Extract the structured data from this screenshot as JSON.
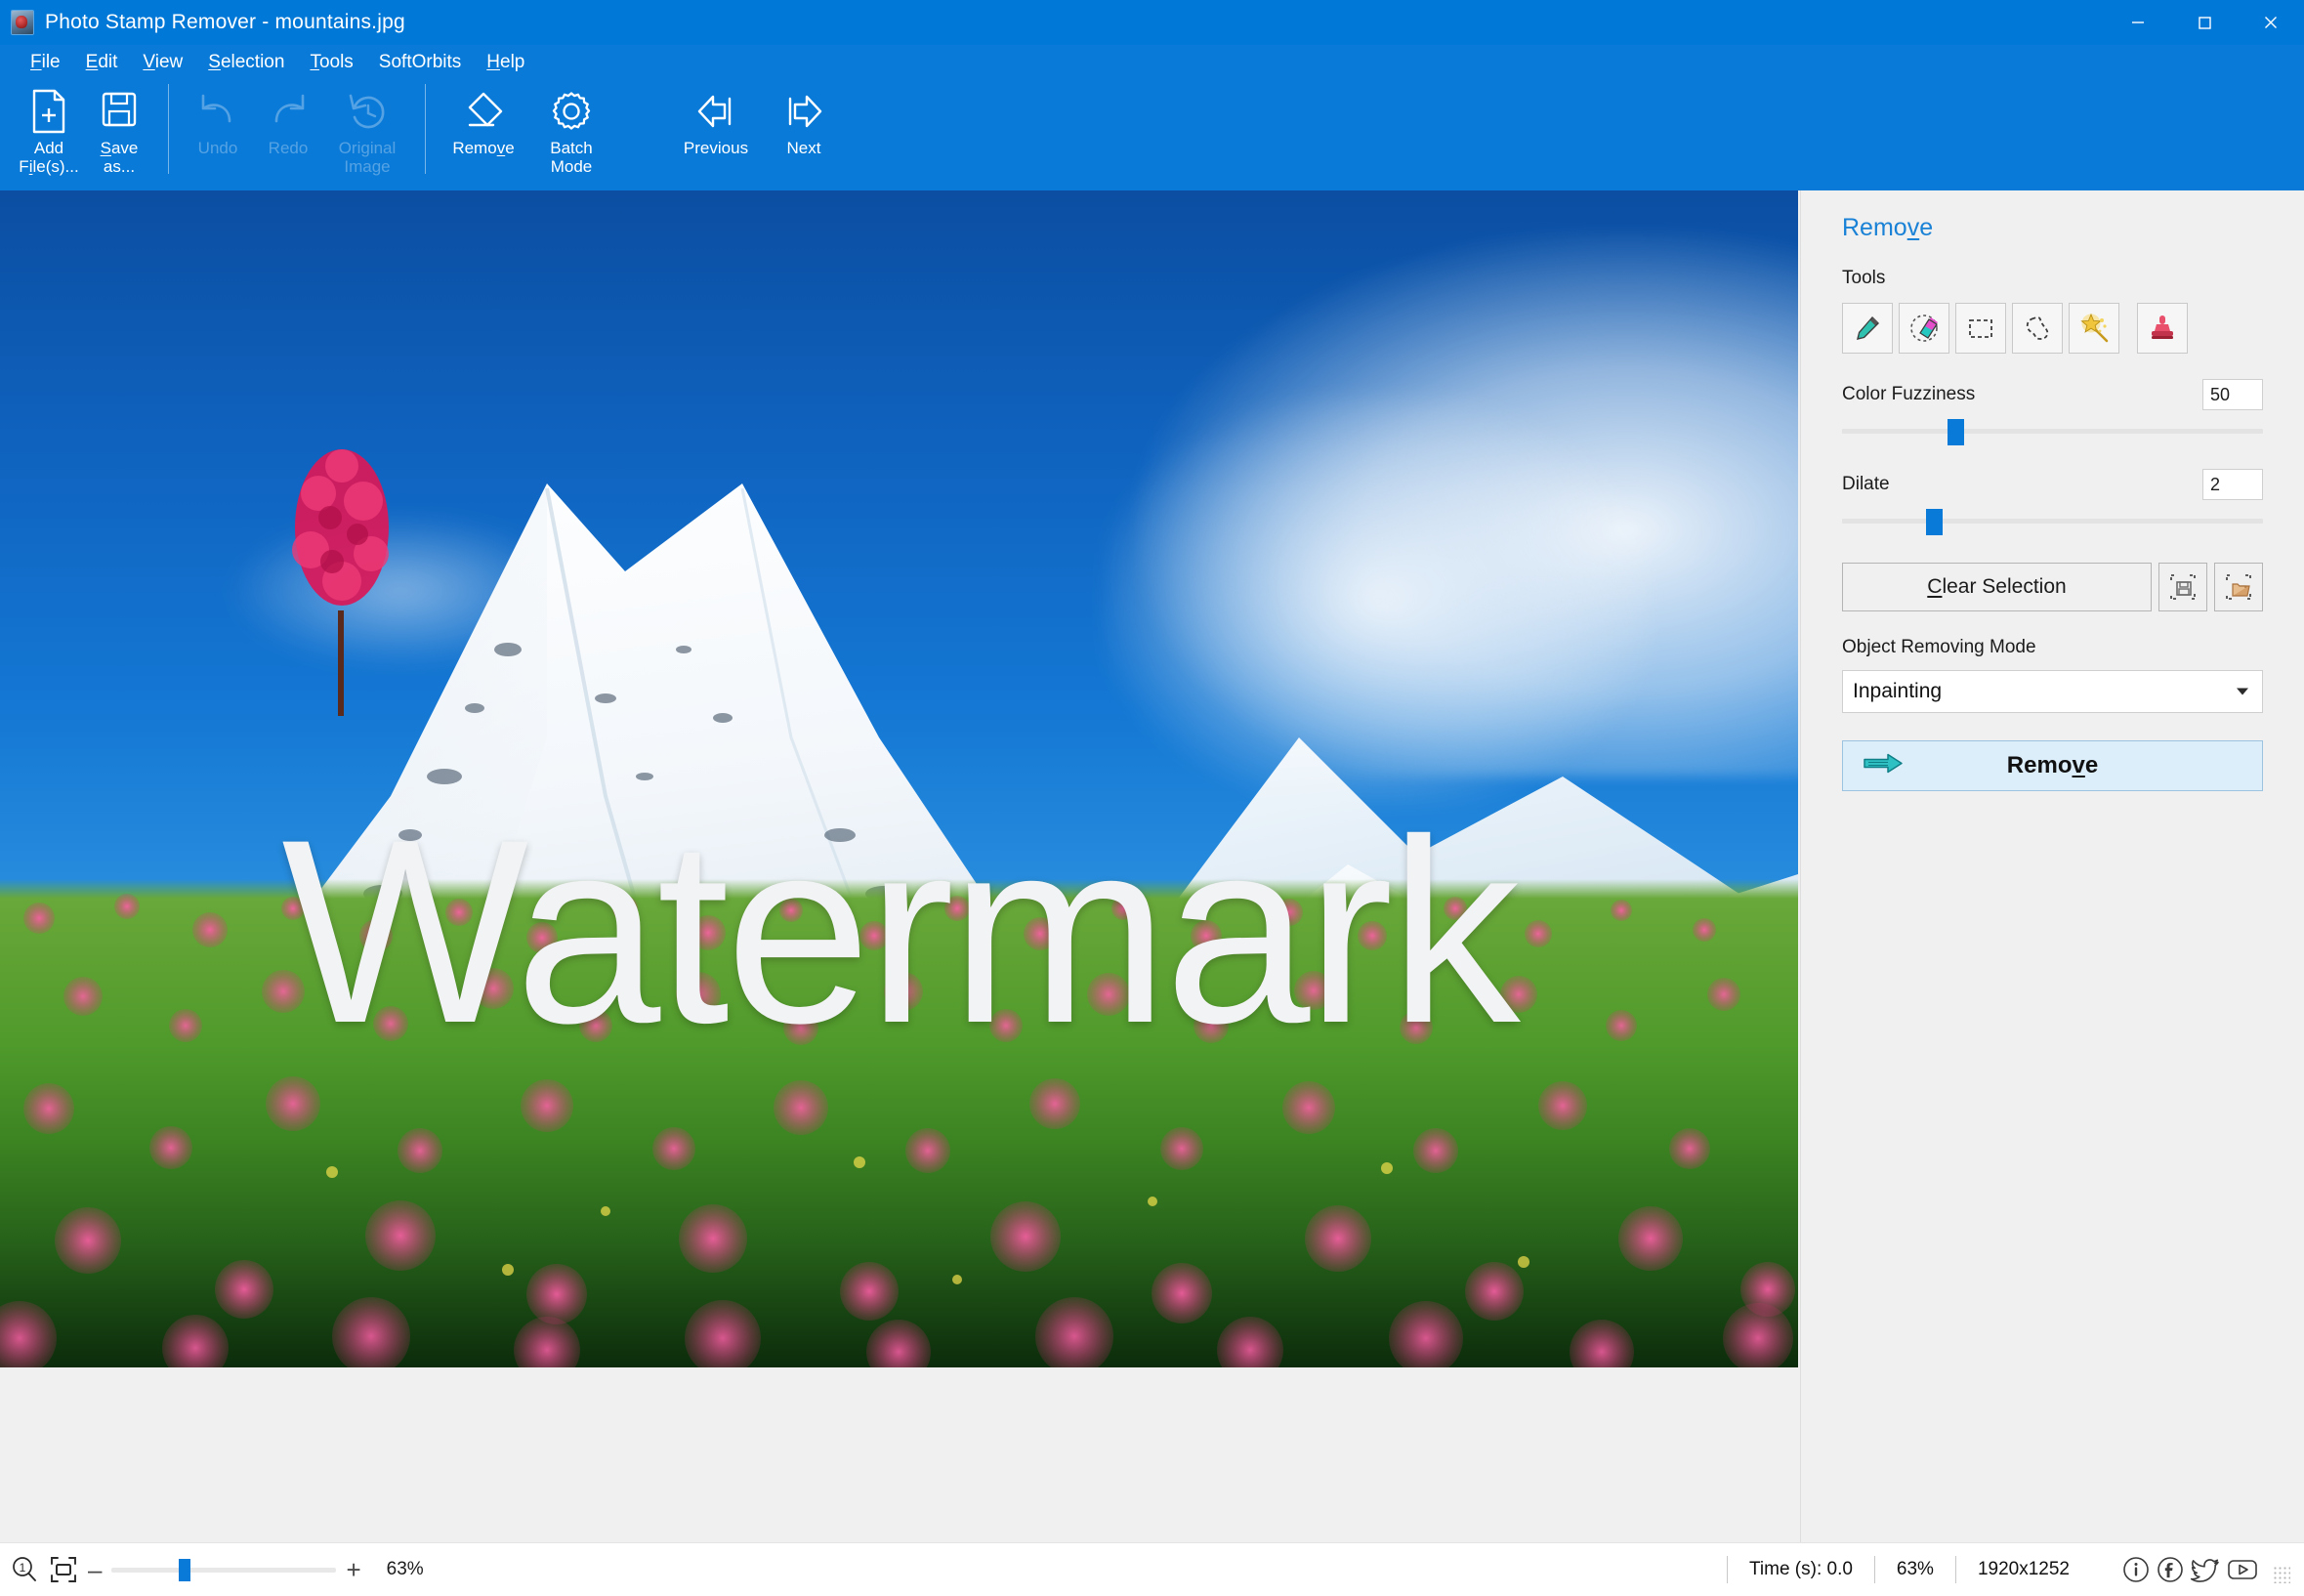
{
  "window": {
    "title": "Photo Stamp Remover - mountains.jpg",
    "app_icon": "app-photo-icon",
    "minimize": "minimize-icon",
    "maximize": "maximize-icon",
    "close": "close-icon",
    "titlebar_color": "#0078d7"
  },
  "menubar": {
    "items": [
      {
        "label": "File",
        "accel": "F"
      },
      {
        "label": "Edit",
        "accel": "E"
      },
      {
        "label": "View",
        "accel": "V"
      },
      {
        "label": "Selection",
        "accel": "S"
      },
      {
        "label": "Tools",
        "accel": "T"
      },
      {
        "label": "SoftOrbits",
        "accel": ""
      },
      {
        "label": "Help",
        "accel": "H"
      }
    ]
  },
  "toolbar": {
    "buttons": [
      {
        "label": "Add\nFile(s)...",
        "icon": "add-file-icon",
        "enabled": true,
        "accel": "l"
      },
      {
        "label": "Save\nas...",
        "icon": "save-as-icon",
        "enabled": true,
        "accel": "S"
      },
      {
        "label": "Undo",
        "icon": "undo-icon",
        "enabled": false
      },
      {
        "label": "Redo",
        "icon": "redo-icon",
        "enabled": false
      },
      {
        "label": "Original\nImage",
        "icon": "history-revert-icon",
        "enabled": false
      },
      {
        "label": "Remove",
        "icon": "eraser-icon",
        "enabled": true,
        "accel": "v"
      },
      {
        "label": "Batch\nMode",
        "icon": "gear-icon",
        "enabled": true
      },
      {
        "label": "Previous",
        "icon": "arrow-left-icon",
        "enabled": true
      },
      {
        "label": "Next",
        "icon": "arrow-right-icon",
        "enabled": true
      }
    ]
  },
  "canvas": {
    "watermark_text": "Watermark",
    "image_name": "mountains.jpg",
    "scene": "snow-capped mountains with pink flower meadow and red blossom tree"
  },
  "panel": {
    "title": "Remove",
    "title_accel": "v",
    "tools_label": "Tools",
    "tools": [
      {
        "name": "marker-tool",
        "selected": false
      },
      {
        "name": "eraser-tool",
        "selected": false
      },
      {
        "name": "rectangle-select-tool",
        "selected": false
      },
      {
        "name": "lasso-select-tool",
        "selected": false
      },
      {
        "name": "magic-wand-tool",
        "selected": false
      },
      {
        "name": "clone-stamp-tool",
        "selected": false
      }
    ],
    "color_fuzziness": {
      "label": "Color Fuzziness",
      "value": "50",
      "percent": 25
    },
    "dilate": {
      "label": "Dilate",
      "value": "2",
      "percent": 20
    },
    "clear_selection": {
      "label": "Clear Selection",
      "accel": "C"
    },
    "save_selection_icon": "save-selection-icon",
    "load_selection_icon": "load-selection-icon",
    "object_removing_mode": {
      "label": "Object Removing Mode",
      "selected": "Inpainting",
      "options": [
        "Inpainting"
      ]
    },
    "remove_button": {
      "label": "Remove",
      "accel": "v",
      "icon": "arrow-right-teal-icon"
    }
  },
  "statusbar": {
    "zoom_100_icon": "zoom-actual-size-icon",
    "fit_icon": "fit-to-window-icon",
    "minus": "–",
    "plus": "+",
    "zoom_percent_left": "63%",
    "zoom_slider_percent": 30,
    "time_label": "Time (s): 0.0",
    "zoom_percent_right": "63%",
    "image_dimensions": "1920x1252",
    "social": [
      {
        "name": "info-icon"
      },
      {
        "name": "facebook-icon"
      },
      {
        "name": "twitter-icon"
      },
      {
        "name": "youtube-icon"
      }
    ]
  }
}
